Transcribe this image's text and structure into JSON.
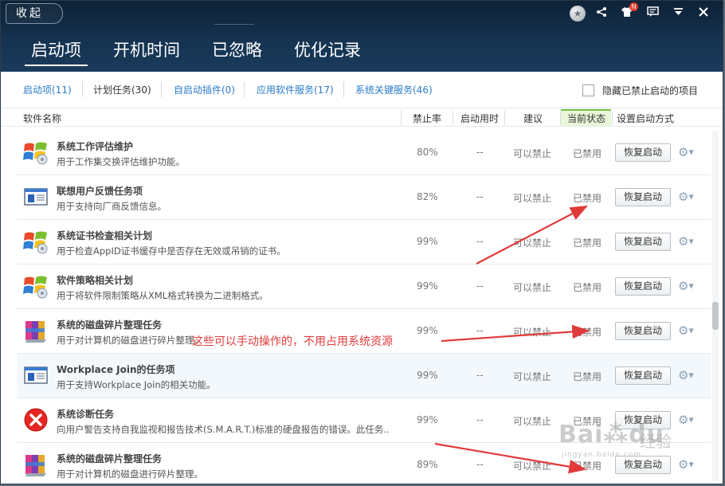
{
  "header": {
    "collapse_label": "收起",
    "tabs": [
      {
        "label": "启动项",
        "active": true
      },
      {
        "label": "开机时间",
        "active": false
      },
      {
        "label": "已忽略",
        "active": false
      },
      {
        "label": "优化记录",
        "active": false
      }
    ],
    "icons": [
      "star-icon",
      "share-icon",
      "tshirt-skin-icon",
      "message-icon",
      "menu-icon",
      "close-icon"
    ],
    "skin_badge": "N"
  },
  "subtabs": [
    {
      "label": "启动项(11)"
    },
    {
      "label": "计划任务(30)"
    },
    {
      "label": "自启动插件(0)"
    },
    {
      "label": "应用软件服务(17)"
    },
    {
      "label": "系统关键服务(46)"
    }
  ],
  "hide_disabled_label": "隐藏已禁止启动的项目",
  "columns": {
    "name": "软件名称",
    "rate": "禁止率",
    "time": "启动用时",
    "advice": "建议",
    "status": "当前状态",
    "method": "设置启动方式"
  },
  "rows": [
    {
      "icon": "windows-logo-icon",
      "title": "系统工作评估维护",
      "desc": "用于工作集交换评估维护功能。",
      "rate": "80%",
      "time": "--",
      "advice": "可以禁止",
      "state": "已禁用",
      "button": "恢复启动"
    },
    {
      "icon": "task-window-icon",
      "title": "联想用户反馈任务项",
      "desc": "用于支持向厂商反馈信息。",
      "rate": "82%",
      "time": "--",
      "advice": "可以禁止",
      "state": "已禁用",
      "button": "恢复启动"
    },
    {
      "icon": "windows-logo-icon",
      "title": "系统证书检查相关计划",
      "desc": "用于检查AppID证书缓存中是否存在无效或吊销的证书。",
      "rate": "99%",
      "time": "--",
      "advice": "可以禁止",
      "state": "已禁用",
      "button": "恢复启动"
    },
    {
      "icon": "windows-logo-icon",
      "title": "软件策略相关计划",
      "desc": "用于将软件限制策略从XML格式转换为二进制格式。",
      "rate": "99%",
      "time": "--",
      "advice": "可以禁止",
      "state": "已禁用",
      "button": "恢复启动"
    },
    {
      "icon": "defrag-icon",
      "title": "系统的磁盘碎片整理任务",
      "desc": "用于对计算机的磁盘进行碎片整理。",
      "rate": "99%",
      "time": "--",
      "advice": "可以禁止",
      "state": "已禁用",
      "button": "恢复启动"
    },
    {
      "icon": "task-window-icon",
      "title": "Workplace Join的任务项",
      "desc": "用于支持Workplace Join的相关功能。",
      "rate": "99%",
      "time": "--",
      "advice": "可以禁止",
      "state": "已禁用",
      "button": "恢复启动"
    },
    {
      "icon": "error-icon",
      "title": "系统诊断任务",
      "desc": "向用户警告支持自我监视和报告技术(S.M.A.R.T.)标准的硬盘报告的错误。此任务..",
      "rate": "99%",
      "time": "--",
      "advice": "可以禁止",
      "state": "已禁用",
      "button": "恢复启动"
    },
    {
      "icon": "defrag-icon",
      "title": "系统的磁盘碎片整理任务",
      "desc": "用于对计算机的磁盘进行碎片整理。",
      "rate": "89%",
      "time": "--",
      "advice": "可以禁止",
      "state": "已禁用",
      "button": "恢复启动"
    }
  ],
  "annotation": "这些可以手动操作的，不用占用系统资源",
  "watermark": {
    "brand": "Bai",
    "brand2": "du",
    "cn": "经验",
    "url": "jingyan.baidu.com"
  },
  "colors": {
    "header_bg": "#163452",
    "link_blue": "#2b7bc8",
    "annotation_red": "#e13a3a",
    "status_green": "#76c043"
  }
}
